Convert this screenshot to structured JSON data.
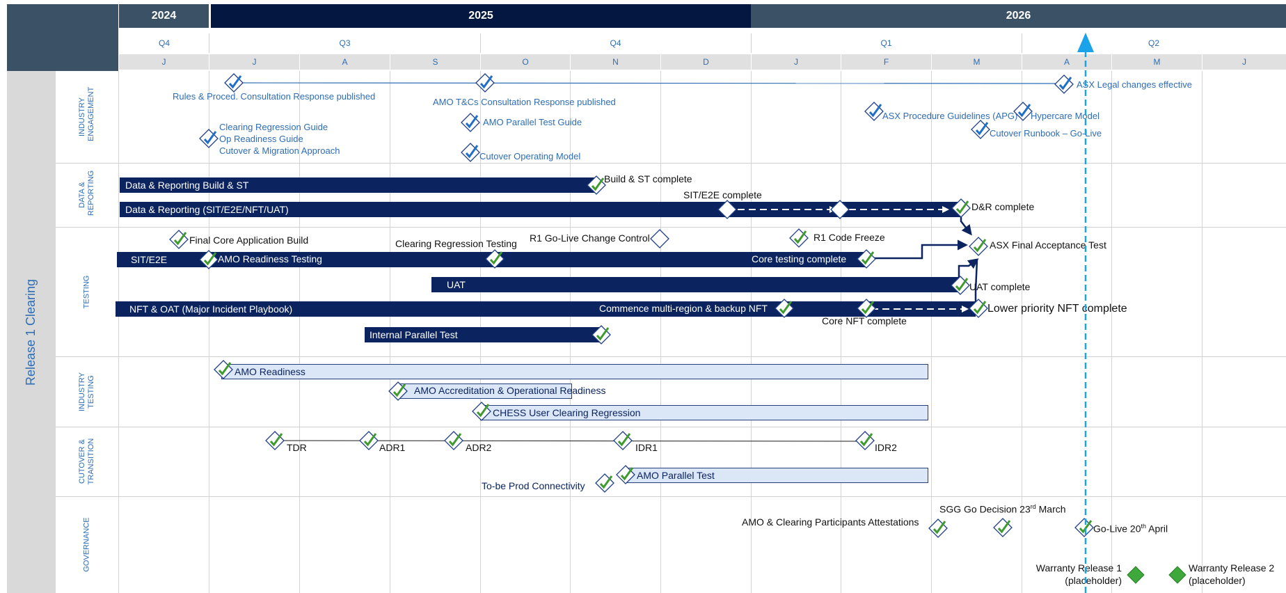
{
  "header": {
    "years": [
      "2024",
      "2025",
      "2026"
    ],
    "quarters": [
      "Q4",
      "Q3",
      "Q4",
      "Q1",
      "Q2"
    ],
    "months": [
      "J",
      "J",
      "A",
      "S",
      "O",
      "N",
      "D",
      "J",
      "F",
      "M",
      "A",
      "M",
      "J"
    ]
  },
  "release_label": "Release 1 Clearing",
  "sections": {
    "industry_engagement": "INDUSTRY ENGAGEMENT",
    "data_reporting": "DATA & REPORTING",
    "testing": "TESTING",
    "industry_testing": "INDUSTRY TESTING",
    "cutover": "CUTOVER & TRANSITION",
    "governance": "GOVERNANCE"
  },
  "engagement": {
    "rules_response": "Rules & Proced. Consultation Response published",
    "amo_tcs": "AMO T&Cs Consultation Response published",
    "asx_legal": "ASX Legal changes effective",
    "clearing_regression_guide": "Clearing Regression Guide",
    "op_readiness_guide": "Op Readiness Guide",
    "cutover_migration": "Cutover & Migration Approach",
    "amo_parallel_test_guide": "AMO Parallel Test Guide",
    "cutover_operating_model": "Cutover Operating Model",
    "asx_procedure_guidelines": "ASX Procedure Guidelines (APG)",
    "hypercare_model": "Hypercare Model",
    "cutover_runbook": "Cutover Runbook – Go-Live"
  },
  "data_reporting": {
    "bar1": "Data & Reporting Build & ST",
    "build_complete": "Build & ST complete",
    "bar2": "Data & Reporting (SIT/E2E/NFT/UAT)",
    "sit_complete": "SIT/E2E complete",
    "dr_complete": "D&R complete"
  },
  "testing": {
    "final_core_build": "Final Core Application Build",
    "clearing_regression_testing": "Clearing Regression Testing",
    "r1_change_control": "R1 Go-Live Change Control",
    "r1_code_freeze": "R1 Code Freeze",
    "asx_final_acceptance": "ASX Final Acceptance Test",
    "sit_e2e": "SIT/E2E",
    "amo_readiness_testing": "AMO Readiness Testing",
    "core_testing_complete": "Core testing complete",
    "uat": "UAT",
    "uat_complete": "UAT complete",
    "nft_oat": "NFT & OAT (Major Incident Playbook)",
    "commence_multi_region": "Commence multi-region & backup NFT",
    "lower_priority_nft": "Lower priority NFT complete",
    "core_nft_complete": "Core NFT complete",
    "internal_parallel_test": "Internal Parallel Test"
  },
  "industry_testing": {
    "amo_readiness": "AMO Readiness",
    "amo_accreditation_a": "AMO Accreditation & Operational",
    "amo_accreditation_b": " Readiness",
    "chess_regression": "CHESS User Clearing Regression"
  },
  "cutover": {
    "tdr": "TDR",
    "adr1": "ADR1",
    "adr2": "ADR2",
    "idr1": "IDR1",
    "idr2": "IDR2",
    "prod_connectivity": "To-be Prod Connectivity",
    "amo_parallel_test": "AMO Parallel Test"
  },
  "governance": {
    "sgg_go_decision_a": "SGG Go Decision 23",
    "sgg_go_decision_sup": "rd",
    "sgg_go_decision_b": " March",
    "attestations": "AMO & Clearing Participants Attestations",
    "go_live_a": "Go-Live 20",
    "go_live_sup": "th",
    "go_live_b": " April",
    "warranty1_a": "Warranty Release 1",
    "warranty1_b": "(placeholder)",
    "warranty2_a": "Warranty Release 2",
    "warranty2_b": "(placeholder)"
  },
  "colors": {
    "navy": "#0b2460",
    "header_navy": "#041740",
    "header_slate": "#3b5266",
    "label_blue": "#2e6db4",
    "check_green": "#3f9a2f",
    "today_line": "#1aa3e8",
    "light_bar": "#dbe6f7"
  }
}
